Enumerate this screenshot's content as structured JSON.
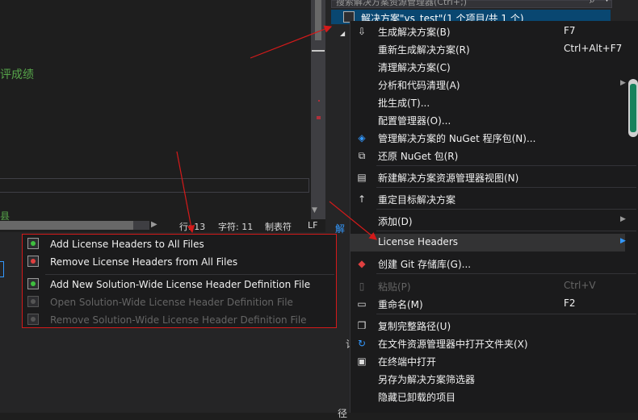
{
  "editor": {
    "green_text": "评成绩",
    "green_text_bottom": "县"
  },
  "status_bar": {
    "line": "行: 13",
    "char": "字符: 11",
    "tab_mode": "制表符",
    "line_ending": "LF"
  },
  "solution_explorer": {
    "search_placeholder": "搜索解决方案资源管理器(Ctrl+;)",
    "selected_item": "解决方案\"vs_test\"(1 个项目/共 1 个)",
    "partial_label": "解",
    "bottom_text_1": "记",
    "bottom_text_2": "径"
  },
  "context_menu": {
    "items": [
      {
        "label": "生成解决方案(B)",
        "shortcut": "F7",
        "icon": "build-icon"
      },
      {
        "label": "重新生成解决方案(R)",
        "shortcut": "Ctrl+Alt+F7"
      },
      {
        "label": "清理解决方案(C)"
      },
      {
        "label": "分析和代码清理(A)",
        "submenu": true
      },
      {
        "label": "批生成(T)..."
      },
      {
        "label": "配置管理器(O)..."
      },
      {
        "label": "管理解决方案的 NuGet 程序包(N)...",
        "icon": "nuget-icon"
      },
      {
        "label": "还原 NuGet 包(R)",
        "icon": "restore-icon"
      },
      {
        "label": "新建解决方案资源管理器视图(N)",
        "icon": "new-view-icon"
      },
      {
        "label": "重定目标解决方案",
        "icon": "up-arrow-icon"
      },
      {
        "label": "添加(D)",
        "submenu": true
      },
      {
        "label": "License Headers",
        "submenu": true
      },
      {
        "label": "创建 Git 存储库(G)...",
        "icon": "git-icon"
      },
      {
        "label": "粘贴(P)",
        "shortcut": "Ctrl+V",
        "disabled": true,
        "icon": "paste-icon"
      },
      {
        "label": "重命名(M)",
        "shortcut": "F2",
        "icon": "rename-icon"
      },
      {
        "label": "复制完整路径(U)",
        "icon": "copy-icon"
      },
      {
        "label": "在文件资源管理器中打开文件夹(X)",
        "icon": "open-folder-icon"
      },
      {
        "label": "在终端中打开",
        "icon": "terminal-icon"
      },
      {
        "label": "另存为解决方案筛选器"
      },
      {
        "label": "隐藏已卸载的项目"
      }
    ]
  },
  "license_submenu": {
    "items": [
      {
        "label": "Add License Headers to All Files"
      },
      {
        "label": "Remove License Headers from All Files"
      },
      {
        "label": "Add New Solution-Wide License Header Definition File"
      },
      {
        "label": "Open Solution-Wide License Header Definition File",
        "disabled": true
      },
      {
        "label": "Remove Solution-Wide License Header Definition File",
        "disabled": true
      }
    ]
  },
  "colors": {
    "accent": "#3399ff",
    "highlight_border": "#d41a1a",
    "comment_green": "#57a64a"
  }
}
